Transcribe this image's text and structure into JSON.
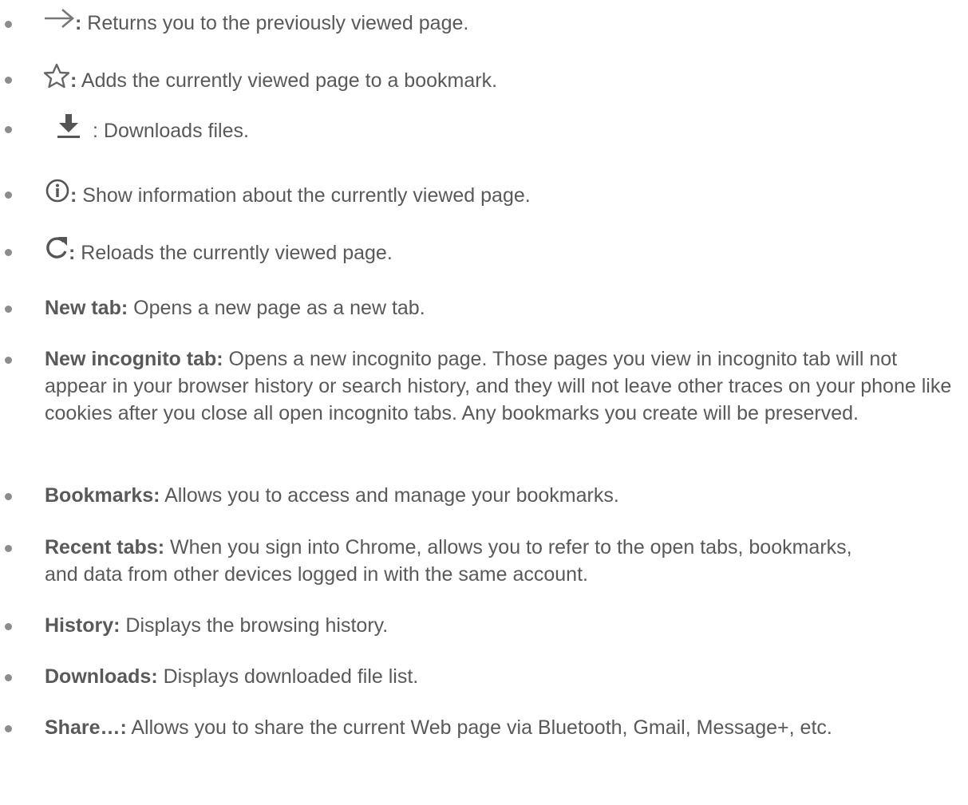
{
  "icon_items": [
    {
      "icon": "arrow-right-icon",
      "suffix": ":",
      "desc": " Returns you to the previously viewed page."
    },
    {
      "icon": "star-outline-icon",
      "suffix": ":",
      "desc": " Adds the currently viewed page to a bookmark."
    },
    {
      "icon": "download-icon",
      "suffix": "",
      "desc": ": Downloads files."
    },
    {
      "icon": "info-circle-icon",
      "suffix": ":",
      "desc": " Show information about the currently viewed page."
    },
    {
      "icon": "reload-icon",
      "suffix": ":",
      "desc": " Reloads the currently viewed page."
    }
  ],
  "term_items": [
    {
      "term": "New tab:",
      "desc": " Opens a new page as a new tab."
    },
    {
      "term": "New incognito tab:",
      "desc": " Opens a new incognito page. Those pages you view in incognito tab will not appear in your browser history or search history, and they will not leave other traces on your phone like cookies after you close all open incognito tabs. Any bookmarks you create will be preserved."
    },
    {
      "term": "Bookmarks:",
      "desc": " Allows you to access and manage your bookmarks."
    },
    {
      "term": "Recent tabs:",
      "desc": " When you sign into Chrome, allows you to refer to the open tabs, bookmarks, and data from other devices logged in with the same account."
    },
    {
      "term": "History:",
      "desc": " Displays the browsing history."
    },
    {
      "term": "Downloads:",
      "desc": " Displays downloaded file list."
    },
    {
      "term": "Share…:",
      "desc": " Allows you to share the current Web page via Bluetooth, Gmail, Message+, etc."
    }
  ],
  "colors": {
    "text": "#595959",
    "bullet": "#8c8c8c",
    "icon": "#666666"
  }
}
